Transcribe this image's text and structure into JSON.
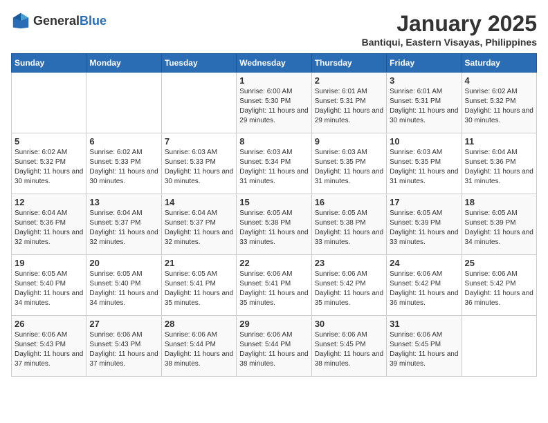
{
  "logo": {
    "general": "General",
    "blue": "Blue"
  },
  "header": {
    "title": "January 2025",
    "subtitle": "Bantiqui, Eastern Visayas, Philippines"
  },
  "weekdays": [
    "Sunday",
    "Monday",
    "Tuesday",
    "Wednesday",
    "Thursday",
    "Friday",
    "Saturday"
  ],
  "weeks": [
    [
      {
        "day": "",
        "sunrise": "",
        "sunset": "",
        "daylight": ""
      },
      {
        "day": "",
        "sunrise": "",
        "sunset": "",
        "daylight": ""
      },
      {
        "day": "",
        "sunrise": "",
        "sunset": "",
        "daylight": ""
      },
      {
        "day": "1",
        "sunrise": "Sunrise: 6:00 AM",
        "sunset": "Sunset: 5:30 PM",
        "daylight": "Daylight: 11 hours and 29 minutes."
      },
      {
        "day": "2",
        "sunrise": "Sunrise: 6:01 AM",
        "sunset": "Sunset: 5:31 PM",
        "daylight": "Daylight: 11 hours and 29 minutes."
      },
      {
        "day": "3",
        "sunrise": "Sunrise: 6:01 AM",
        "sunset": "Sunset: 5:31 PM",
        "daylight": "Daylight: 11 hours and 30 minutes."
      },
      {
        "day": "4",
        "sunrise": "Sunrise: 6:02 AM",
        "sunset": "Sunset: 5:32 PM",
        "daylight": "Daylight: 11 hours and 30 minutes."
      }
    ],
    [
      {
        "day": "5",
        "sunrise": "Sunrise: 6:02 AM",
        "sunset": "Sunset: 5:32 PM",
        "daylight": "Daylight: 11 hours and 30 minutes."
      },
      {
        "day": "6",
        "sunrise": "Sunrise: 6:02 AM",
        "sunset": "Sunset: 5:33 PM",
        "daylight": "Daylight: 11 hours and 30 minutes."
      },
      {
        "day": "7",
        "sunrise": "Sunrise: 6:03 AM",
        "sunset": "Sunset: 5:33 PM",
        "daylight": "Daylight: 11 hours and 30 minutes."
      },
      {
        "day": "8",
        "sunrise": "Sunrise: 6:03 AM",
        "sunset": "Sunset: 5:34 PM",
        "daylight": "Daylight: 11 hours and 31 minutes."
      },
      {
        "day": "9",
        "sunrise": "Sunrise: 6:03 AM",
        "sunset": "Sunset: 5:35 PM",
        "daylight": "Daylight: 11 hours and 31 minutes."
      },
      {
        "day": "10",
        "sunrise": "Sunrise: 6:03 AM",
        "sunset": "Sunset: 5:35 PM",
        "daylight": "Daylight: 11 hours and 31 minutes."
      },
      {
        "day": "11",
        "sunrise": "Sunrise: 6:04 AM",
        "sunset": "Sunset: 5:36 PM",
        "daylight": "Daylight: 11 hours and 31 minutes."
      }
    ],
    [
      {
        "day": "12",
        "sunrise": "Sunrise: 6:04 AM",
        "sunset": "Sunset: 5:36 PM",
        "daylight": "Daylight: 11 hours and 32 minutes."
      },
      {
        "day": "13",
        "sunrise": "Sunrise: 6:04 AM",
        "sunset": "Sunset: 5:37 PM",
        "daylight": "Daylight: 11 hours and 32 minutes."
      },
      {
        "day": "14",
        "sunrise": "Sunrise: 6:04 AM",
        "sunset": "Sunset: 5:37 PM",
        "daylight": "Daylight: 11 hours and 32 minutes."
      },
      {
        "day": "15",
        "sunrise": "Sunrise: 6:05 AM",
        "sunset": "Sunset: 5:38 PM",
        "daylight": "Daylight: 11 hours and 33 minutes."
      },
      {
        "day": "16",
        "sunrise": "Sunrise: 6:05 AM",
        "sunset": "Sunset: 5:38 PM",
        "daylight": "Daylight: 11 hours and 33 minutes."
      },
      {
        "day": "17",
        "sunrise": "Sunrise: 6:05 AM",
        "sunset": "Sunset: 5:39 PM",
        "daylight": "Daylight: 11 hours and 33 minutes."
      },
      {
        "day": "18",
        "sunrise": "Sunrise: 6:05 AM",
        "sunset": "Sunset: 5:39 PM",
        "daylight": "Daylight: 11 hours and 34 minutes."
      }
    ],
    [
      {
        "day": "19",
        "sunrise": "Sunrise: 6:05 AM",
        "sunset": "Sunset: 5:40 PM",
        "daylight": "Daylight: 11 hours and 34 minutes."
      },
      {
        "day": "20",
        "sunrise": "Sunrise: 6:05 AM",
        "sunset": "Sunset: 5:40 PM",
        "daylight": "Daylight: 11 hours and 34 minutes."
      },
      {
        "day": "21",
        "sunrise": "Sunrise: 6:05 AM",
        "sunset": "Sunset: 5:41 PM",
        "daylight": "Daylight: 11 hours and 35 minutes."
      },
      {
        "day": "22",
        "sunrise": "Sunrise: 6:06 AM",
        "sunset": "Sunset: 5:41 PM",
        "daylight": "Daylight: 11 hours and 35 minutes."
      },
      {
        "day": "23",
        "sunrise": "Sunrise: 6:06 AM",
        "sunset": "Sunset: 5:42 PM",
        "daylight": "Daylight: 11 hours and 35 minutes."
      },
      {
        "day": "24",
        "sunrise": "Sunrise: 6:06 AM",
        "sunset": "Sunset: 5:42 PM",
        "daylight": "Daylight: 11 hours and 36 minutes."
      },
      {
        "day": "25",
        "sunrise": "Sunrise: 6:06 AM",
        "sunset": "Sunset: 5:42 PM",
        "daylight": "Daylight: 11 hours and 36 minutes."
      }
    ],
    [
      {
        "day": "26",
        "sunrise": "Sunrise: 6:06 AM",
        "sunset": "Sunset: 5:43 PM",
        "daylight": "Daylight: 11 hours and 37 minutes."
      },
      {
        "day": "27",
        "sunrise": "Sunrise: 6:06 AM",
        "sunset": "Sunset: 5:43 PM",
        "daylight": "Daylight: 11 hours and 37 minutes."
      },
      {
        "day": "28",
        "sunrise": "Sunrise: 6:06 AM",
        "sunset": "Sunset: 5:44 PM",
        "daylight": "Daylight: 11 hours and 38 minutes."
      },
      {
        "day": "29",
        "sunrise": "Sunrise: 6:06 AM",
        "sunset": "Sunset: 5:44 PM",
        "daylight": "Daylight: 11 hours and 38 minutes."
      },
      {
        "day": "30",
        "sunrise": "Sunrise: 6:06 AM",
        "sunset": "Sunset: 5:45 PM",
        "daylight": "Daylight: 11 hours and 38 minutes."
      },
      {
        "day": "31",
        "sunrise": "Sunrise: 6:06 AM",
        "sunset": "Sunset: 5:45 PM",
        "daylight": "Daylight: 11 hours and 39 minutes."
      },
      {
        "day": "",
        "sunrise": "",
        "sunset": "",
        "daylight": ""
      }
    ]
  ]
}
